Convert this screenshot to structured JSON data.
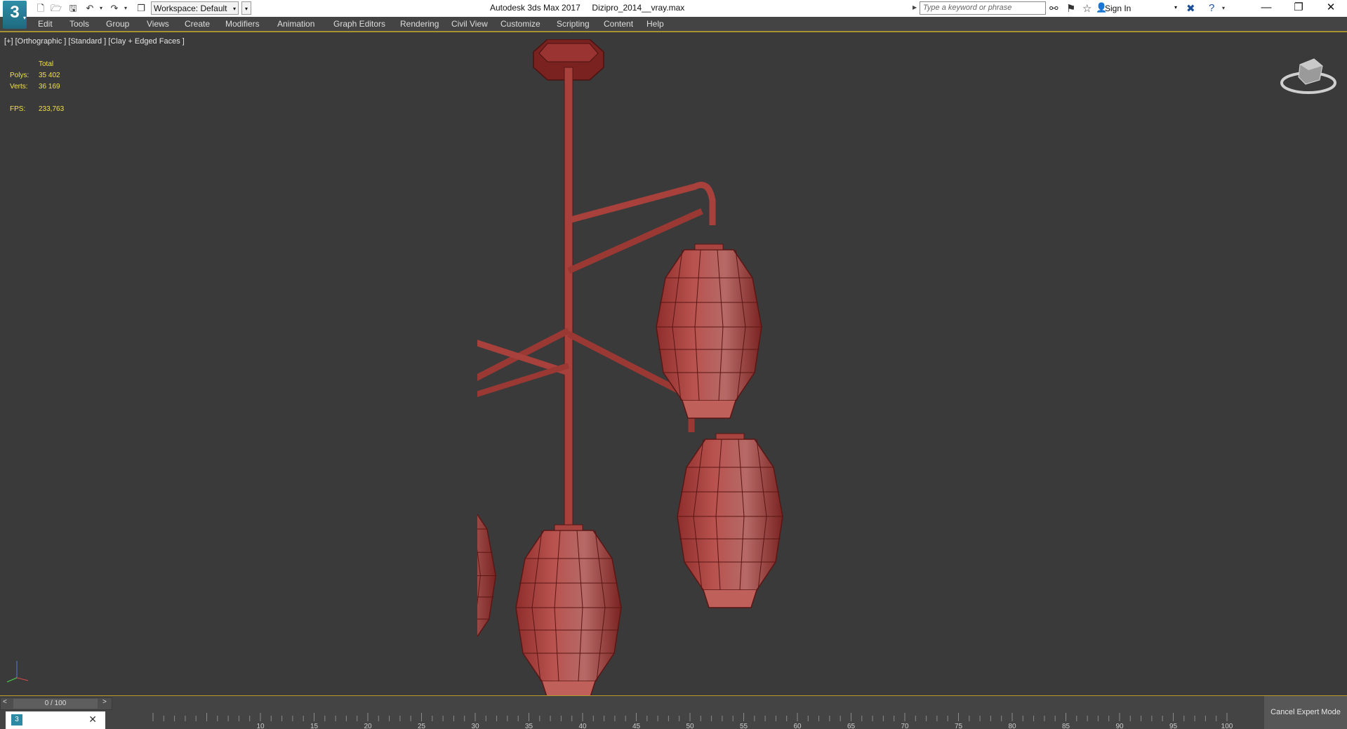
{
  "titlebar": {
    "app_name": "Autodesk 3ds Max 2017",
    "file_name": "Dizipro_2014__vray.max",
    "workspace_label": "Workspace: Default",
    "search_placeholder": "Type a keyword or phrase",
    "sign_in_label": "Sign In",
    "logo_text": "3"
  },
  "menu": [
    "Edit",
    "Tools",
    "Group",
    "Views",
    "Create",
    "Modifiers",
    "Animation",
    "Graph Editors",
    "Rendering",
    "Civil View",
    "Customize",
    "Scripting",
    "Content",
    "Help"
  ],
  "viewport": {
    "label": "[+] [Orthographic ] [Standard ] [Clay + Edged Faces ]",
    "stats": {
      "header": "Total",
      "polys_label": "Polys:",
      "polys_value": "35 402",
      "verts_label": "Verts:",
      "verts_value": "36 169",
      "fps_label": "FPS:",
      "fps_value": "233,763"
    }
  },
  "timeline": {
    "frame_display": "0 / 100",
    "ticks": [
      "10",
      "15",
      "20",
      "25",
      "30",
      "35",
      "40",
      "45",
      "50",
      "55",
      "60",
      "65",
      "70",
      "75",
      "80",
      "85",
      "90",
      "95",
      "100"
    ],
    "current_frame": 0,
    "total_frames": 100
  },
  "expert_mode_button": "Cancel Expert Mode",
  "colors": {
    "viewport_bg": "#3a3a3a",
    "stats_text": "#f2e04c",
    "model_color": "#b0504c",
    "active_border": "#b59a2a"
  }
}
